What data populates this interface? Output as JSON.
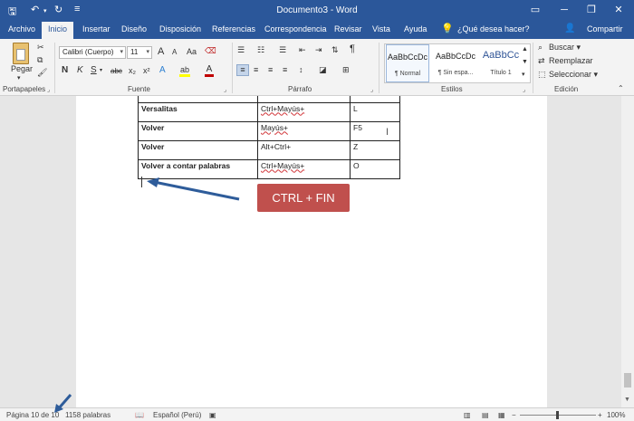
{
  "window": {
    "title": "Documento3 - Word",
    "minimize_glyph": "─",
    "restore_glyph": "❐",
    "close_glyph": "✕",
    "options_glyph": "▭"
  },
  "quick_access": {
    "save_glyph": "🖫",
    "undo_glyph": "↶",
    "redo_glyph": "↻",
    "more_glyph": "≡"
  },
  "tabs": [
    {
      "label": "Archivo"
    },
    {
      "label": "Inicio"
    },
    {
      "label": "Insertar"
    },
    {
      "label": "Diseño"
    },
    {
      "label": "Disposición"
    },
    {
      "label": "Referencias"
    },
    {
      "label": "Correspondencia"
    },
    {
      "label": "Revisar"
    },
    {
      "label": "Vista"
    },
    {
      "label": "Ayuda"
    }
  ],
  "tell_me": {
    "icon": "lightbulb-icon",
    "label": "¿Qué desea hacer?"
  },
  "share": {
    "label": "Compartir"
  },
  "ribbon": {
    "clipboard": {
      "paste_label": "Pegar",
      "group_label": "Portapapeles"
    },
    "font": {
      "font_name": "Calibri (Cuerpo)",
      "font_size": "11",
      "group_label": "Fuente",
      "bold": "N",
      "italic": "K",
      "underline": "S",
      "strike": "abc",
      "subscript": "x₂",
      "superscript": "x²",
      "grow": "A",
      "shrink": "A",
      "case": "Aa",
      "effects": "A",
      "highlight": "ab",
      "color": "A"
    },
    "paragraph": {
      "group_label": "Párrafo",
      "pilcrow": "¶"
    },
    "styles": {
      "group_label": "Estilos",
      "items": [
        {
          "preview": "AaBbCcDc",
          "name": "¶ Normal"
        },
        {
          "preview": "AaBbCcDc",
          "name": "¶ Sin espa..."
        },
        {
          "preview": "AaBbCc",
          "name": "Título 1"
        }
      ]
    },
    "editing": {
      "group_label": "Edición",
      "find": "Buscar",
      "replace": "Reemplazar",
      "select": "Seleccionar"
    }
  },
  "document": {
    "rows": [
      {
        "action": "Versalitas",
        "keys": "Ctrl+Mayús+",
        "key": "L"
      },
      {
        "action": "Volver",
        "keys": "Mayús+",
        "key": "F5"
      },
      {
        "action": "Volver",
        "keys": "Alt+Ctrl+",
        "key": "Z"
      },
      {
        "action": "Volver a contar palabras",
        "keys": "Ctrl+Mayús+",
        "key": "O"
      }
    ],
    "callout": "CTRL + FIN"
  },
  "status_bar": {
    "page": "Página 10 de 10",
    "words": "1158 palabras",
    "language": "Español (Perú)",
    "zoom": "100%"
  },
  "colors": {
    "title_bar": "#2b579a",
    "callout": "#c0504d",
    "arrow": "#2e5c9a",
    "font_color_bar": "#c00000",
    "highlight_bar": "#ffff00"
  }
}
